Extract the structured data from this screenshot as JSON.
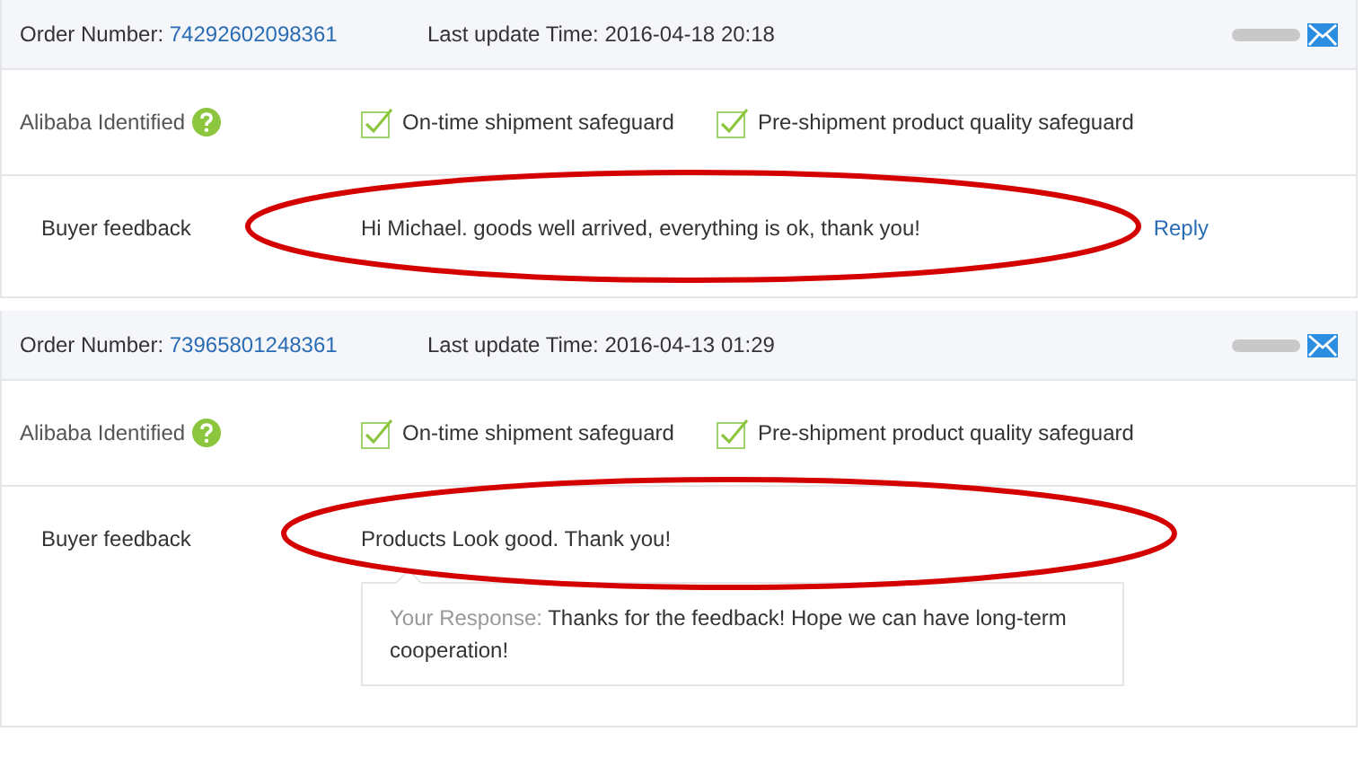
{
  "orders": [
    {
      "order_label": "Order Number:",
      "order_number": "74292602098361",
      "update_label": "Last update Time:",
      "update_time": "2016-04-18 20:18",
      "identified_label": "Alibaba Identified",
      "safeguards": [
        {
          "label": "On-time shipment safeguard",
          "checked": true
        },
        {
          "label": "Pre-shipment product quality safeguard",
          "checked": true
        }
      ],
      "feedback_label": "Buyer feedback",
      "feedback": "Hi Michael. goods well arrived, everything is ok, thank you!",
      "reply_link": "Reply",
      "circled": true
    },
    {
      "order_label": "Order Number:",
      "order_number": "73965801248361",
      "update_label": "Last update Time:",
      "update_time": "2016-04-13 01:29",
      "identified_label": "Alibaba Identified",
      "safeguards": [
        {
          "label": "On-time shipment safeguard",
          "checked": true
        },
        {
          "label": "Pre-shipment product quality safeguard",
          "checked": true
        }
      ],
      "feedback_label": "Buyer feedback",
      "feedback": "Products Look good. Thank you!",
      "response_label": "Your Response:",
      "response": "Thanks for the feedback! Hope we can have long-term cooperation!",
      "circled": true
    }
  ]
}
